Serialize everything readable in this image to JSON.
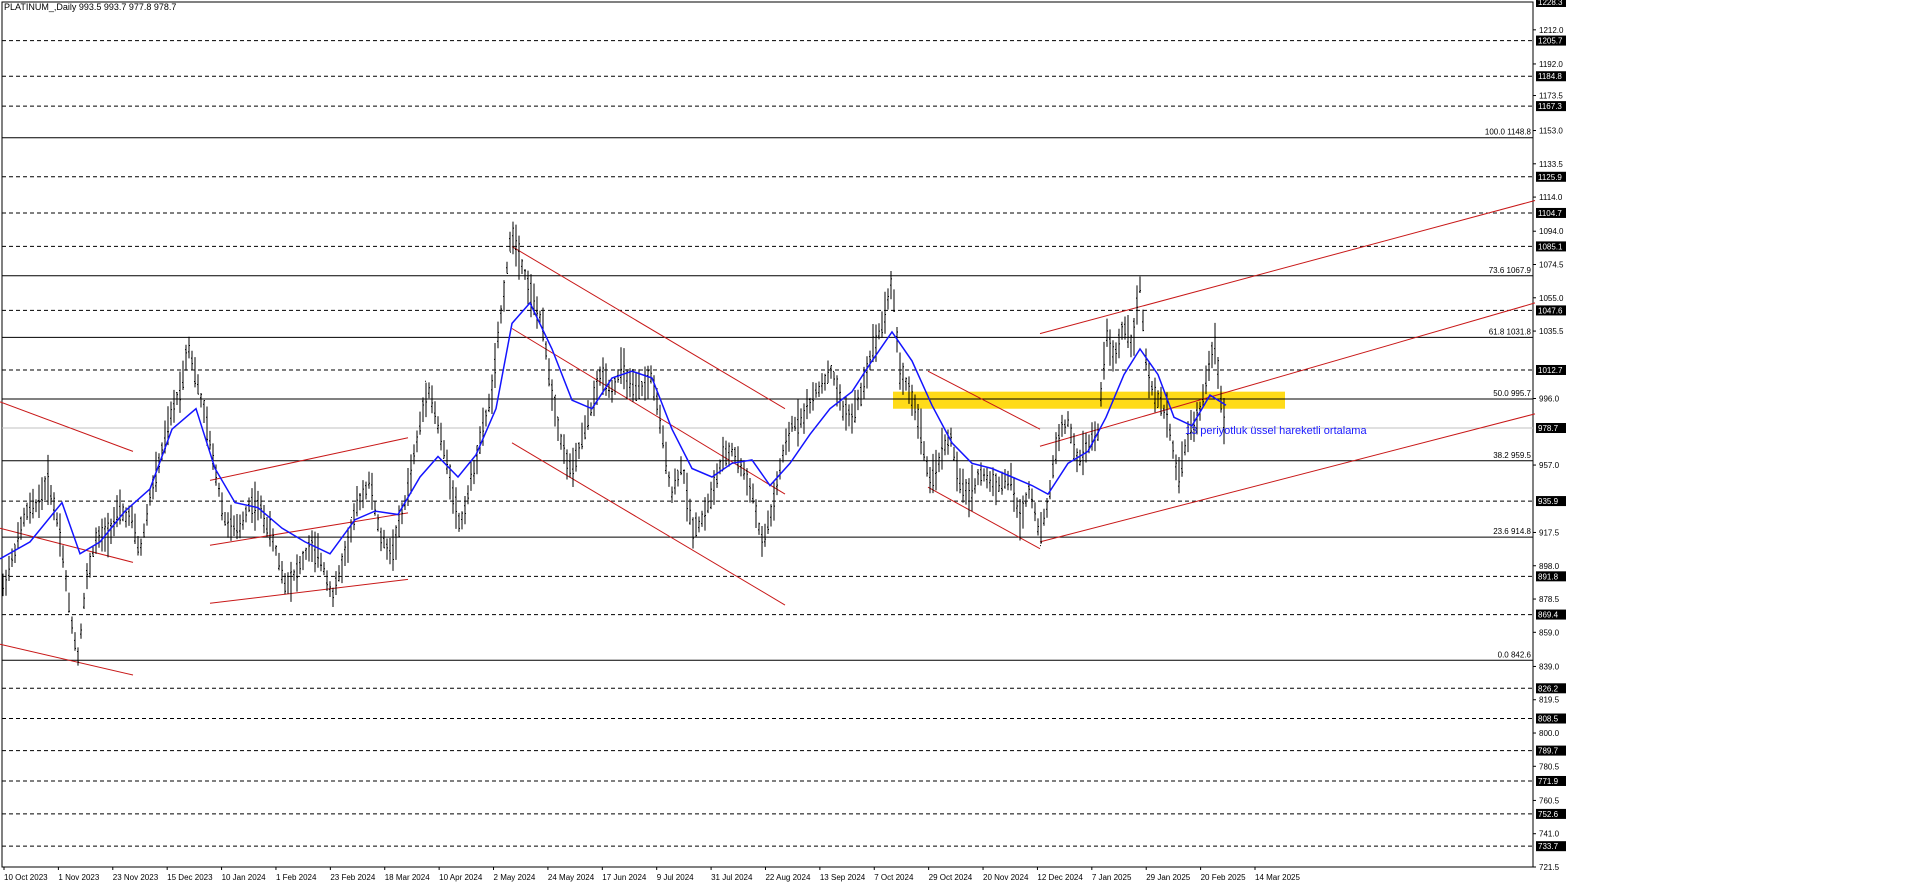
{
  "header": {
    "title": "PLATINUM_,Daily  993.5 993.7 977.8 978.7"
  },
  "chart_data": {
    "type": "candlestick",
    "symbol": "PLATINUM_",
    "timeframe": "Daily",
    "ohlc_label": "993.5 993.7 977.8 978.7",
    "ylim": [
      721.5,
      1228.3
    ],
    "x_tick_labels": [
      "10 Oct 2023",
      "1 Nov 2023",
      "23 Nov 2023",
      "15 Dec 2023",
      "10 Jan 2024",
      "1 Feb 2024",
      "23 Feb 2024",
      "18 Mar 2024",
      "10 Apr 2024",
      "2 May 2024",
      "24 May 2024",
      "17 Jun 2024",
      "9 Jul 2024",
      "31 Jul 2024",
      "22 Aug 2024",
      "13 Sep 2024",
      "7 Oct 2024",
      "29 Oct 2024",
      "20 Nov 2024",
      "12 Dec 2024",
      "7 Jan 2025",
      "29 Jan 2025",
      "20 Feb 2025",
      "14 Mar 2025"
    ],
    "y_tick_labels": [
      "1212.0",
      "1192.0",
      "1173.5",
      "1153.0",
      "1133.5",
      "1114.0",
      "1094.0",
      "1074.5",
      "1055.0",
      "1035.5",
      "996.0",
      "957.0",
      "917.5",
      "898.0",
      "878.5",
      "859.0",
      "839.0",
      "819.5",
      "800.0",
      "780.5",
      "760.5",
      "741.0",
      "721.5"
    ],
    "horizontal_levels": [
      {
        "value": 1228.3,
        "label": "1228.3",
        "style": "dashed"
      },
      {
        "value": 1205.7,
        "label": "1205.7",
        "style": "dashed"
      },
      {
        "value": 1184.8,
        "label": "1184.8",
        "style": "dashed"
      },
      {
        "value": 1167.3,
        "label": "1167.3",
        "style": "dashed"
      },
      {
        "value": 1125.9,
        "label": "1125.9",
        "style": "dashed"
      },
      {
        "value": 1104.7,
        "label": "1104.7",
        "style": "dashed"
      },
      {
        "value": 1085.1,
        "label": "1085.1",
        "style": "dashed"
      },
      {
        "value": 1047.6,
        "label": "1047.6",
        "style": "dashed"
      },
      {
        "value": 1012.7,
        "label": "1012.7",
        "style": "dashed"
      },
      {
        "value": 978.7,
        "label": "978.7",
        "style": "current"
      },
      {
        "value": 935.9,
        "label": "935.9",
        "style": "dashed"
      },
      {
        "value": 891.8,
        "label": "891.8",
        "style": "dashed"
      },
      {
        "value": 869.4,
        "label": "869.4",
        "style": "dashed"
      },
      {
        "value": 826.2,
        "label": "826.2",
        "style": "dashed"
      },
      {
        "value": 808.5,
        "label": "808.5",
        "style": "dashed"
      },
      {
        "value": 789.7,
        "label": "789.7",
        "style": "dashed"
      },
      {
        "value": 771.9,
        "label": "771.9",
        "style": "dashed"
      },
      {
        "value": 752.6,
        "label": "752.6",
        "style": "dashed"
      },
      {
        "value": 733.7,
        "label": "733.7",
        "style": "dashed"
      }
    ],
    "fibonacci": [
      {
        "level": "100.0",
        "value": 1148.8,
        "label": "100.0 1148.8"
      },
      {
        "level": "73.6",
        "value": 1067.9,
        "label": "73.6 1067.9"
      },
      {
        "level": "61.8",
        "value": 1031.8,
        "label": "61.8 1031.8"
      },
      {
        "level": "50.0",
        "value": 995.7,
        "label": "50.0 995.7"
      },
      {
        "level": "38.2",
        "value": 959.5,
        "label": "38.2 959.5"
      },
      {
        "level": "23.6",
        "value": 914.8,
        "label": "23.6 914.8"
      },
      {
        "level": "0.0",
        "value": 842.6,
        "label": "0.0 842.6"
      }
    ],
    "price_path": [
      [
        0,
        880
      ],
      [
        14,
        905
      ],
      [
        25,
        928
      ],
      [
        38,
        935
      ],
      [
        48,
        948
      ],
      [
        60,
        918
      ],
      [
        70,
        870
      ],
      [
        78,
        845
      ],
      [
        86,
        888
      ],
      [
        95,
        912
      ],
      [
        108,
        918
      ],
      [
        120,
        930
      ],
      [
        132,
        925
      ],
      [
        140,
        905
      ],
      [
        150,
        938
      ],
      [
        160,
        960
      ],
      [
        172,
        988
      ],
      [
        182,
        1005
      ],
      [
        188,
        1030
      ],
      [
        196,
        1008
      ],
      [
        205,
        985
      ],
      [
        215,
        955
      ],
      [
        225,
        925
      ],
      [
        238,
        918
      ],
      [
        250,
        935
      ],
      [
        260,
        932
      ],
      [
        272,
        915
      ],
      [
        285,
        888
      ],
      [
        298,
        895
      ],
      [
        310,
        910
      ],
      [
        322,
        900
      ],
      [
        333,
        880
      ],
      [
        345,
        905
      ],
      [
        358,
        935
      ],
      [
        370,
        948
      ],
      [
        380,
        915
      ],
      [
        392,
        905
      ],
      [
        405,
        935
      ],
      [
        415,
        965
      ],
      [
        428,
        1005
      ],
      [
        438,
        980
      ],
      [
        450,
        950
      ],
      [
        460,
        920
      ],
      [
        470,
        945
      ],
      [
        482,
        975
      ],
      [
        492,
        1000
      ],
      [
        502,
        1050
      ],
      [
        512,
        1095
      ],
      [
        522,
        1075
      ],
      [
        532,
        1055
      ],
      [
        542,
        1040
      ],
      [
        552,
        1000
      ],
      [
        562,
        968
      ],
      [
        572,
        952
      ],
      [
        582,
        972
      ],
      [
        592,
        992
      ],
      [
        602,
        1012
      ],
      [
        612,
        1000
      ],
      [
        622,
        1015
      ],
      [
        632,
        1000
      ],
      [
        642,
        1002
      ],
      [
        652,
        1010
      ],
      [
        662,
        975
      ],
      [
        672,
        940
      ],
      [
        682,
        958
      ],
      [
        692,
        920
      ],
      [
        702,
        925
      ],
      [
        712,
        940
      ],
      [
        722,
        960
      ],
      [
        732,
        966
      ],
      [
        742,
        955
      ],
      [
        752,
        942
      ],
      [
        762,
        910
      ],
      [
        772,
        930
      ],
      [
        782,
        960
      ],
      [
        792,
        980
      ],
      [
        802,
        985
      ],
      [
        812,
        995
      ],
      [
        822,
        1005
      ],
      [
        832,
        1012
      ],
      [
        842,
        990
      ],
      [
        852,
        985
      ],
      [
        862,
        1000
      ],
      [
        872,
        1025
      ],
      [
        882,
        1040
      ],
      [
        892,
        1065
      ],
      [
        900,
        1012
      ],
      [
        910,
        1000
      ],
      [
        920,
        980
      ],
      [
        930,
        945
      ],
      [
        940,
        962
      ],
      [
        950,
        975
      ],
      [
        960,
        945
      ],
      [
        970,
        940
      ],
      [
        980,
        952
      ],
      [
        990,
        948
      ],
      [
        1000,
        945
      ],
      [
        1010,
        950
      ],
      [
        1020,
        925
      ],
      [
        1030,
        945
      ],
      [
        1040,
        915
      ],
      [
        1048,
        935
      ],
      [
        1058,
        975
      ],
      [
        1068,
        982
      ],
      [
        1078,
        958
      ],
      [
        1088,
        970
      ],
      [
        1098,
        975
      ],
      [
        1106,
        1035
      ],
      [
        1114,
        1018
      ],
      [
        1124,
        1040
      ],
      [
        1132,
        1028
      ],
      [
        1140,
        1062
      ],
      [
        1148,
        1005
      ],
      [
        1158,
        995
      ],
      [
        1168,
        985
      ],
      [
        1178,
        948
      ],
      [
        1188,
        975
      ],
      [
        1198,
        985
      ],
      [
        1208,
        1010
      ],
      [
        1215,
        1030
      ],
      [
        1222,
        990
      ],
      [
        1226,
        978.7
      ]
    ],
    "ema": {
      "name": "13 periyotluk üssel hareketli ortalama",
      "color": "#1414ff",
      "points": [
        [
          0,
          902
        ],
        [
          30,
          912
        ],
        [
          62,
          935
        ],
        [
          80,
          905
        ],
        [
          100,
          912
        ],
        [
          125,
          930
        ],
        [
          150,
          943
        ],
        [
          172,
          978
        ],
        [
          196,
          990
        ],
        [
          215,
          955
        ],
        [
          235,
          935
        ],
        [
          258,
          932
        ],
        [
          282,
          920
        ],
        [
          305,
          912
        ],
        [
          330,
          905
        ],
        [
          355,
          925
        ],
        [
          375,
          930
        ],
        [
          398,
          928
        ],
        [
          420,
          950
        ],
        [
          438,
          962
        ],
        [
          458,
          950
        ],
        [
          476,
          963
        ],
        [
          496,
          990
        ],
        [
          512,
          1040
        ],
        [
          530,
          1052
        ],
        [
          552,
          1025
        ],
        [
          572,
          995
        ],
        [
          592,
          990
        ],
        [
          612,
          1008
        ],
        [
          632,
          1012
        ],
        [
          652,
          1008
        ],
        [
          672,
          978
        ],
        [
          692,
          955
        ],
        [
          712,
          950
        ],
        [
          732,
          958
        ],
        [
          752,
          960
        ],
        [
          770,
          945
        ],
        [
          790,
          958
        ],
        [
          810,
          975
        ],
        [
          830,
          990
        ],
        [
          852,
          1000
        ],
        [
          872,
          1018
        ],
        [
          892,
          1035
        ],
        [
          912,
          1018
        ],
        [
          932,
          992
        ],
        [
          952,
          970
        ],
        [
          972,
          958
        ],
        [
          992,
          955
        ],
        [
          1012,
          950
        ],
        [
          1032,
          945
        ],
        [
          1048,
          940
        ],
        [
          1068,
          958
        ],
        [
          1088,
          965
        ],
        [
          1106,
          985
        ],
        [
          1124,
          1010
        ],
        [
          1140,
          1025
        ],
        [
          1158,
          1010
        ],
        [
          1174,
          985
        ],
        [
          1192,
          980
        ],
        [
          1210,
          998
        ],
        [
          1226,
          992
        ]
      ]
    },
    "horizontal_zone": {
      "from": 1000.0,
      "to": 990.0,
      "x_start": 893,
      "x_end": 1285,
      "color": "#ffd700"
    },
    "trendlines": [
      {
        "x1": 0,
        "y1": 994.0,
        "x2": 133,
        "y2": 965.0
      },
      {
        "x1": 0,
        "y1": 920.0,
        "x2": 133,
        "y2": 900.0
      },
      {
        "x1": 0,
        "y1": 852.0,
        "x2": 133,
        "y2": 834.0
      },
      {
        "x1": 210,
        "y1": 948.0,
        "x2": 408,
        "y2": 973.0
      },
      {
        "x1": 210,
        "y1": 910.0,
        "x2": 408,
        "y2": 929.0
      },
      {
        "x1": 210,
        "y1": 876.0,
        "x2": 408,
        "y2": 890.0
      },
      {
        "x1": 512,
        "y1": 1085.0,
        "x2": 785,
        "y2": 990.0
      },
      {
        "x1": 512,
        "y1": 1037.0,
        "x2": 785,
        "y2": 940.0
      },
      {
        "x1": 512,
        "y1": 970.0,
        "x2": 785,
        "y2": 875.0
      },
      {
        "x1": 928,
        "y1": 1012.0,
        "x2": 1040,
        "y2": 978.0
      },
      {
        "x1": 928,
        "y1": 944.0,
        "x2": 1040,
        "y2": 908.0
      },
      {
        "x1": 1040,
        "y1": 1034.0,
        "x2": 1535,
        "y2": 1112.0
      },
      {
        "x1": 1040,
        "y1": 968.0,
        "x2": 1535,
        "y2": 1052.0
      },
      {
        "x1": 1040,
        "y1": 912.0,
        "x2": 1535,
        "y2": 987.0
      }
    ],
    "annotation": "13 periyotluk üssel hareketli ortalama"
  }
}
